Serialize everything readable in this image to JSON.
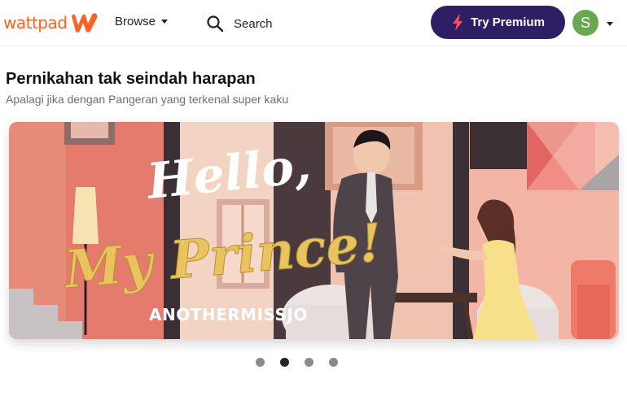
{
  "nav": {
    "logo_text": "wattpad",
    "browse_label": "Browse",
    "search_label": "Search",
    "premium_label": "Try Premium",
    "avatar_initial": "S"
  },
  "story": {
    "title": "Pernikahan tak seindah harapan",
    "subtitle": "Apalagi jika dengan Pangeran yang terkenal super kaku"
  },
  "banner": {
    "cover_title_line1": "Hello,",
    "cover_title_line2": "My Prince!",
    "author": "ANOTHERMISSJO"
  },
  "carousel": {
    "slides": 4,
    "active_index": 1
  },
  "colors": {
    "brand": "#ff6122",
    "premium_bg": "#2e1e63",
    "premium_bolt": "#ff4d5a",
    "avatar_bg": "#6aa84f"
  },
  "icons": {
    "search": "search-icon",
    "bolt": "bolt-icon",
    "caret": "chevron-down-icon"
  }
}
